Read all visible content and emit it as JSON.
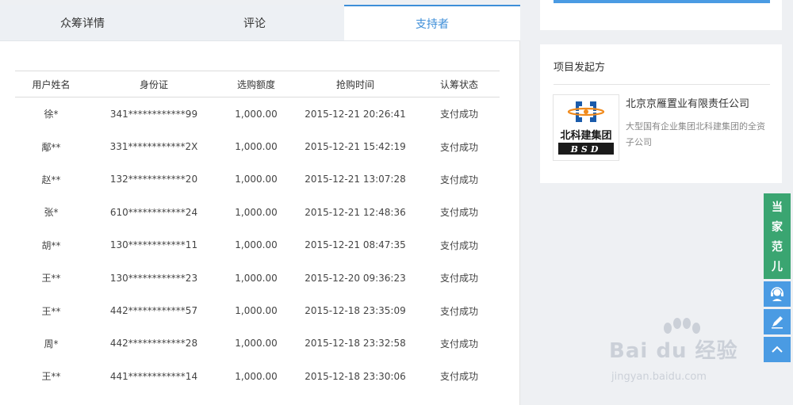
{
  "tabs": [
    {
      "label": "众筹详情",
      "active": false
    },
    {
      "label": "评论",
      "active": false
    },
    {
      "label": "支持者",
      "active": true
    }
  ],
  "table": {
    "headers": [
      "用户姓名",
      "身份证",
      "选购额度",
      "抢购时间",
      "认筹状态"
    ],
    "rows": [
      [
        "徐*",
        "341************99",
        "1,000.00",
        "2015-12-21 20:26:41",
        "支付成功"
      ],
      [
        "鄅**",
        "331************2X",
        "1,000.00",
        "2015-12-21 15:42:19",
        "支付成功"
      ],
      [
        "赵**",
        "132************20",
        "1,000.00",
        "2015-12-21 13:07:28",
        "支付成功"
      ],
      [
        "张*",
        "610************24",
        "1,000.00",
        "2015-12-21 12:48:36",
        "支付成功"
      ],
      [
        "胡**",
        "130************11",
        "1,000.00",
        "2015-12-21 08:47:35",
        "支付成功"
      ],
      [
        "王**",
        "130************23",
        "1,000.00",
        "2015-12-20 09:36:23",
        "支付成功"
      ],
      [
        "王**",
        "442************57",
        "1,000.00",
        "2015-12-18 23:35:09",
        "支付成功"
      ],
      [
        "周*",
        "442************28",
        "1,000.00",
        "2015-12-18 23:32:58",
        "支付成功"
      ],
      [
        "王**",
        "441************14",
        "1,000.00",
        "2015-12-18 23:30:06",
        "支付成功"
      ]
    ]
  },
  "sponsor": {
    "title": "项目发起方",
    "company_name": "北京京雁置业有限责任公司",
    "description": "大型国有企业集团北科建集团的全资子公司",
    "logo_text_cn": "北科建集团",
    "logo_text_en": "BSD"
  },
  "side_float": {
    "brand_chars": [
      "当",
      "家",
      "范",
      "儿"
    ],
    "buttons": [
      "customer-service-icon",
      "edit-icon",
      "back-to-top-icon"
    ]
  },
  "watermark": {
    "text": "Bai du 经验",
    "url": "jingyan.baidu.com"
  },
  "colors": {
    "accent": "#3d8ed8",
    "side_blue": "#4a9be3",
    "brand_green": "#3aa571",
    "logo_blue": "#1a5bab"
  }
}
